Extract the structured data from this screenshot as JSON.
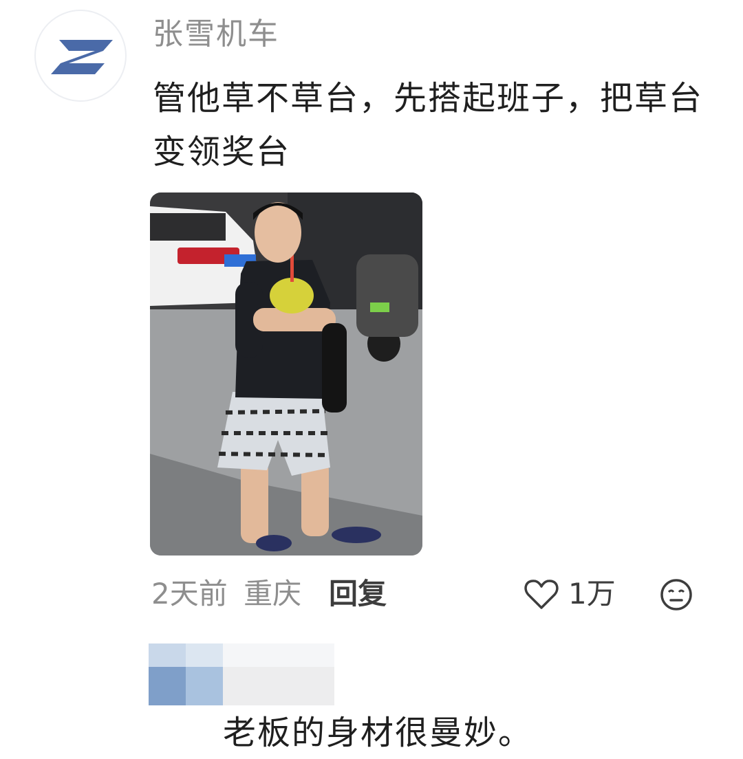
{
  "comment": {
    "avatar_icon": "z-logo-icon",
    "username": "张雪机车",
    "text": "管他草不草台，先搭起班子，把草台变领奖台",
    "photo_alt": "photo",
    "time": "2天前",
    "location": "重庆",
    "reply_label": "回复",
    "like_icon": "heart-icon",
    "like_count": "1万",
    "emoji_icon": "emoji-face-icon"
  },
  "reply_comment": {
    "text": "老板的身材很曼妙。"
  },
  "colors": {
    "accent": "#4a6aa8",
    "muted": "#8e8e8e"
  }
}
